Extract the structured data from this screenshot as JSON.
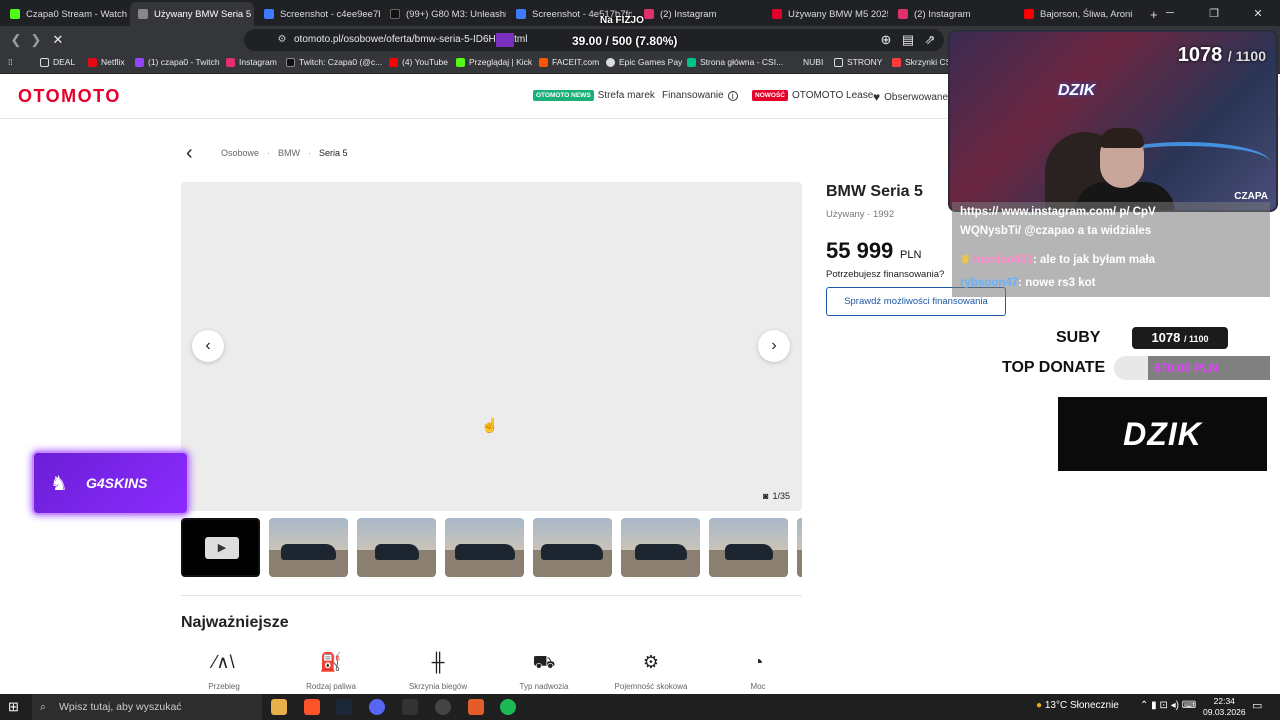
{
  "browser": {
    "tabs": [
      {
        "label": "Czapa0 Stream - Watch Li",
        "color": "#53fc18"
      },
      {
        "label": "Używany BMW Seria 5",
        "color": "#888888",
        "active": true
      },
      {
        "label": "Screenshot - c4ee9ee7bfa",
        "color": "#3d7bff"
      },
      {
        "label": "(99+) G80 M3: Unleashing",
        "color": "#111111"
      },
      {
        "label": "Screenshot - 4e517b7fda",
        "color": "#3d7bff"
      },
      {
        "label": "(2) Instagram",
        "color": "#e1306c"
      },
      {
        "label": "Używany BMW M5 2025",
        "color": "#e4002b"
      },
      {
        "label": "(2) Instagram",
        "color": "#e1306c"
      },
      {
        "label": "Bajorson, Śliwa, Aroni",
        "color": "#ff0000"
      }
    ],
    "new_tab": "+",
    "url": "otomoto.pl/osobowe/oferta/bmw-seria-5-ID6HR       .html",
    "bookmarks": [
      {
        "label": "DEAL",
        "color": "#dadce0"
      },
      {
        "label": "Netflix",
        "color": "#e50914"
      },
      {
        "label": "(1) czapa0 - Twitch",
        "color": "#9146ff"
      },
      {
        "label": "Instagram",
        "color": "#e1306c"
      },
      {
        "label": "Twitch: Czapa0 (@c...",
        "color": "#111111"
      },
      {
        "label": "(4) YouTube",
        "color": "#ff0000"
      },
      {
        "label": "Przeglądaj | Kick",
        "color": "#53fc18"
      },
      {
        "label": "FACEIT.com",
        "color": "#ff5500"
      },
      {
        "label": "Epic Games Pay",
        "color": "#dadce0"
      },
      {
        "label": "Strona główna - CSI...",
        "color": "#00c28b"
      },
      {
        "label": "NUBI",
        "color": "#35363a"
      },
      {
        "label": "STRONY",
        "color": "#dadce0"
      },
      {
        "label": "Skrzynki CS",
        "color": "#ff3d3d"
      }
    ]
  },
  "site": {
    "logo": "OTOMOTO",
    "nav": {
      "news_pill": "OTOMOTO NEWS",
      "brands": "Strefa marek",
      "financing": "Finansowanie",
      "new_pill": "NOWOŚĆ",
      "lease": "OTOMOTO Lease",
      "saved": "Obserwowane"
    },
    "breadcrumb": [
      "Osobowe",
      "BMW",
      "Seria 5"
    ],
    "gallery": {
      "count": "1/35"
    },
    "section_title": "Najważniejsze",
    "features": [
      "Przebieg",
      "Rodzaj paliwa",
      "Skrzynia biegów",
      "Typ nadwozia",
      "Pojemność skokowa",
      "Moc"
    ],
    "listing": {
      "title": "BMW Seria 5",
      "subtitle": "Używany · 1992",
      "price": "55 999",
      "currency": "PLN",
      "financing_question": "Potrzebujesz finansowania?",
      "financing_button": "Sprawdź możliwości finansowania"
    }
  },
  "stream": {
    "fizjo": "Na FIZJO",
    "stats": "39.00 / 500 (7.80%)",
    "subs_top": "1078",
    "subs_top_goal": "/ 1100",
    "dzik": "DZIK",
    "cam_name": "CZAPA",
    "chat": [
      {
        "user": "",
        "text": "https:// www.instagram.com/ p/ CpV"
      },
      {
        "user": "",
        "text": "WQNysbTi/ @czapao a ta widziales"
      },
      {
        "user": "maniao401",
        "text": "ale to jak byłam mała"
      },
      {
        "user": "rybsoon47",
        "text": "nowe rs3 kot"
      }
    ],
    "subs_label": "SUBY",
    "subs_value": "1078",
    "subs_goal": "/ 1100",
    "donate_label": "TOP DONATE",
    "donate_value": "670.00 PLN",
    "sponsor": "G4SKINS",
    "banner": "DZIK"
  },
  "taskbar": {
    "search_placeholder": "Wpisz tutaj, aby wyszukać",
    "weather": "13°C  Słonecznie",
    "time": "22:34",
    "date": "09.03.2026"
  }
}
